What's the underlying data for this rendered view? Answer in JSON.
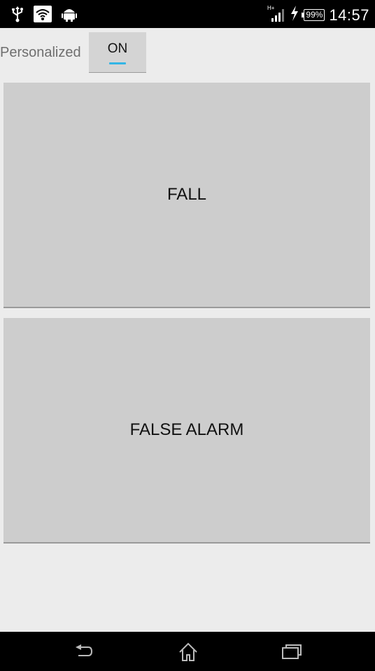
{
  "status_bar": {
    "time": "14:57",
    "battery_percent": "99%",
    "network_label": "H+",
    "icons_left": [
      "usb-icon",
      "wifi-icon",
      "android-debug-icon"
    ],
    "icons_right": [
      "signal-icon",
      "charging-icon",
      "battery-icon"
    ]
  },
  "settings": {
    "personalized_label": "Personalized",
    "toggle_label": "ON"
  },
  "buttons": {
    "fall_label": "FALL",
    "false_alarm_label": "FALSE ALARM"
  },
  "nav_bar": {
    "icons": [
      "back-icon",
      "home-icon",
      "recents-icon"
    ]
  },
  "colors": {
    "background": "#ececec",
    "button_bg": "#cdcdcd",
    "accent": "#33b5e5",
    "bars": "#000000"
  }
}
